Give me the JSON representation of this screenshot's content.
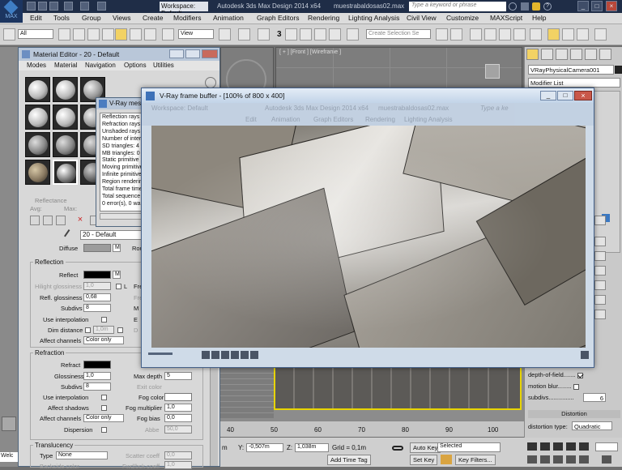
{
  "app": {
    "title": "Autodesk 3ds Max Design 2014 x64",
    "file": "muestrabaldosas02.max",
    "workspace": "Workspace: Default",
    "search_placeholder": "Type a keyword or phrase",
    "logo": "MAX"
  },
  "menu": [
    "Edit",
    "Tools",
    "Group",
    "Views",
    "Create",
    "Modifiers",
    "Animation",
    "Graph Editors",
    "Rendering",
    "Lighting Analysis",
    "Civil View",
    "Customize",
    "MAXScript",
    "Help"
  ],
  "toolbar": {
    "selection_filter": "All",
    "ref_coord": "View",
    "snap_label": "3",
    "named_selection_placeholder": "Create Selection Se"
  },
  "viewports": {
    "front_label": "[ + ] [Front ] [Wireframe ]"
  },
  "command_panel": {
    "object_name": "VRayPhysicalCamera001",
    "modifier_list": "Modifier List",
    "rows": [
      {
        "label": "depth-of-field",
        "checked": true
      },
      {
        "label": "motion blur",
        "checked": false
      }
    ],
    "subdivs_label": "subdivs",
    "subdivs_value": "6",
    "distortion_header": "Distortion",
    "distortion_type_label": "distortion type",
    "distortion_type_value": "Quadratic"
  },
  "material_editor": {
    "title": "Material Editor - 20 - Default",
    "menu": [
      "Modes",
      "Material",
      "Navigation",
      "Options",
      "Utilities"
    ],
    "reflectance": "Reflectance",
    "avg": "Avg:",
    "max": "Max:",
    "material_name": "20 - Default",
    "diffuse": "Diffuse",
    "diffuse_m": "M",
    "rough": "Rou",
    "reflection": {
      "header": "Reflection",
      "reflect": "Reflect",
      "reflect_m": "M",
      "hilight_glossiness": "Hilight glossiness",
      "hilight_value": "1,0",
      "l_flag": "L",
      "fr": "Fre",
      "refl_glossiness": "Refl. glossiness",
      "refl_value": "0,68",
      "subdivs": "Subdivs",
      "subdivs_value": "8",
      "use_interpolation": "Use interpolation",
      "dim_distance": "Dim distance",
      "dim_value": "1,0m",
      "affect_channels": "Affect channels",
      "affect_value": "Color only",
      "m_lbl": "M",
      "e_lbl": "E",
      "d_lbl": "D",
      "fr2": "Fre"
    },
    "refraction": {
      "header": "Refraction",
      "refract": "Refract",
      "glossiness": "Glossiness",
      "glossiness_value": "1,0",
      "subdivs": "Subdivs",
      "subdivs_value": "8",
      "use_interpolation": "Use interpolation",
      "affect_shadows": "Affect shadows",
      "affect_channels": "Affect channels",
      "affect_value": "Color only",
      "dispersion": "Dispersion",
      "max_depth": "Max depth",
      "max_depth_value": "5",
      "exit_color": "Exit color",
      "fog_color": "Fog color",
      "fog_multiplier": "Fog multiplier",
      "fog_multiplier_value": "1,0",
      "fog_bias": "Fog bias",
      "fog_bias_value": "0,0",
      "abbe": "Abbe",
      "abbe_value": "50,0"
    },
    "translucency": {
      "header": "Translucency",
      "type": "Type",
      "type_value": "None",
      "scatter_coeff": "Scatter coeff",
      "scatter_value": "0,0",
      "backside_color": "Backside color",
      "fwd_bck": "Fwd/bck coeff",
      "fwd_value": "1,0"
    }
  },
  "vray_messages": {
    "title": "V-Ray mes",
    "lines": [
      "Reflection rays",
      "Refraction rays",
      "Unshaded rays",
      "Number of inters",
      "SD triangles: 4",
      "MB triangles: 0",
      "Static primitive",
      "Moving primitive",
      "Infinite primitive",
      "Region rendering",
      "Total frame time",
      "Total sequence",
      "0 error(s), 0 warn"
    ]
  },
  "frame_buffer": {
    "title": "V-Ray frame buffer - [100% of 800 x 400]",
    "behind_title": "Autodesk 3ds Max Design 2014 x64",
    "behind_file": "muestrabaldosas02.max",
    "behind_workspace": "Workspace: Default",
    "behind_search": "Type a ke",
    "behind_menu": [
      "Edit",
      "Animation",
      "Graph Editors",
      "Rendering",
      "Lighting Analysis"
    ]
  },
  "timeline": {
    "ticks": [
      "40",
      "50",
      "60",
      "70",
      "80",
      "90",
      "100"
    ]
  },
  "status": {
    "x_value": "",
    "y_label": "Y:",
    "y_value": "-0,507m",
    "z_label": "Z:",
    "z_value": "1,038m",
    "grid": "Grid = 0,1m",
    "auto_key": "Auto Key",
    "selected": "Selected",
    "set_key": "Set Key",
    "key_filters": "Key Filters...",
    "add_time_tag": "Add Time Tag",
    "welcome": "Welc",
    "m_label": "m"
  },
  "colors": {
    "titlebar": "#1f2d47",
    "accent": "#3f7ec4",
    "selection_yellow": "#e8d400"
  }
}
